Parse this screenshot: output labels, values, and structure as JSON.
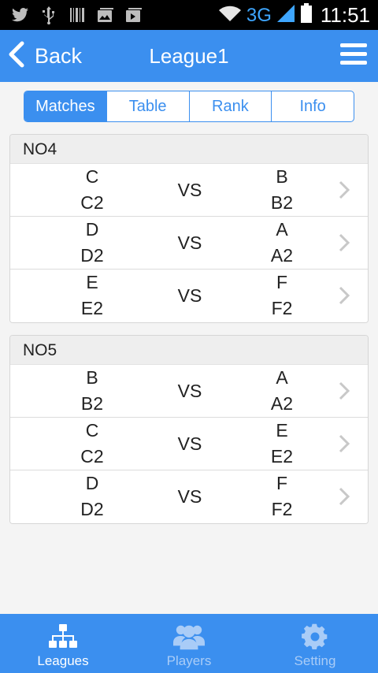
{
  "status_bar": {
    "network": "3G",
    "time": "11:51",
    "left_icons": [
      "twitter-icon",
      "usb-icon",
      "barcode-icon",
      "photo-icon",
      "photo-stack-icon"
    ]
  },
  "app_bar": {
    "back_label": "Back",
    "title": "League1"
  },
  "tabs": [
    {
      "label": "Matches",
      "active": true
    },
    {
      "label": "Table",
      "active": false
    },
    {
      "label": "Rank",
      "active": false
    },
    {
      "label": "Info",
      "active": false
    }
  ],
  "rounds": [
    {
      "label": "NO4",
      "matches": [
        {
          "home": "C",
          "home_sub": "C2",
          "vs": "VS",
          "away": "B",
          "away_sub": "B2"
        },
        {
          "home": "D",
          "home_sub": "D2",
          "vs": "VS",
          "away": "A",
          "away_sub": "A2"
        },
        {
          "home": "E",
          "home_sub": "E2",
          "vs": "VS",
          "away": "F",
          "away_sub": "F2"
        }
      ]
    },
    {
      "label": "NO5",
      "matches": [
        {
          "home": "B",
          "home_sub": "B2",
          "vs": "VS",
          "away": "A",
          "away_sub": "A2"
        },
        {
          "home": "C",
          "home_sub": "C2",
          "vs": "VS",
          "away": "E",
          "away_sub": "E2"
        },
        {
          "home": "D",
          "home_sub": "D2",
          "vs": "VS",
          "away": "F",
          "away_sub": "F2"
        }
      ]
    }
  ],
  "bottom_nav": [
    {
      "label": "Leagues",
      "icon": "hierarchy-icon",
      "active": true
    },
    {
      "label": "Players",
      "icon": "people-icon",
      "active": false
    },
    {
      "label": "Setting",
      "icon": "gear-icon",
      "active": false
    }
  ],
  "colors": {
    "primary": "#3b8fef",
    "inactive_nav": "#a9ccf7",
    "header_bg": "#eeeeee"
  }
}
